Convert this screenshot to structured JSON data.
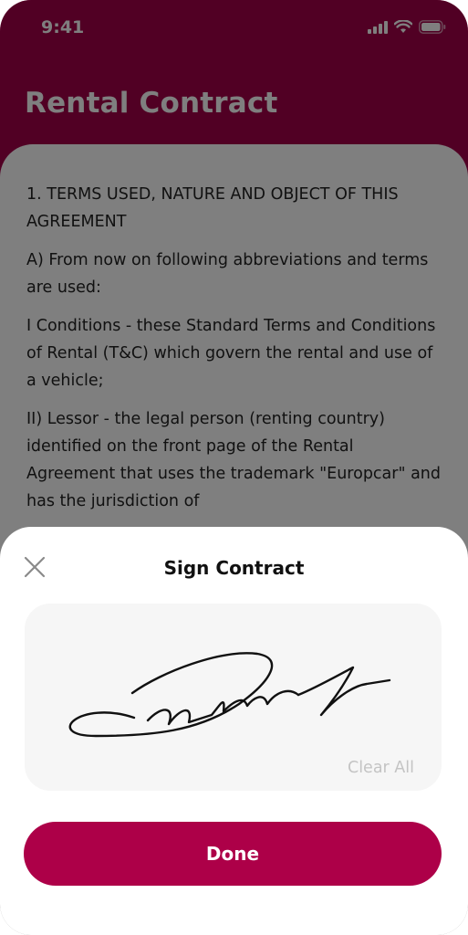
{
  "status_bar": {
    "time": "9:41"
  },
  "page": {
    "title": "Rental Contract"
  },
  "contract": {
    "paragraphs": [
      "1. TERMS USED, NATURE AND OBJECT OF THIS AGREEMENT",
      "A) From now on following abbreviations and terms are used:",
      "I Conditions - these Standard Terms and Conditions of Rental (T&C) which govern the rental and use of a vehicle;",
      "II) Lessor - the legal person (renting country) identified on the front page of the Rental Agreement that uses the trademark \"Europcar\" and has the jurisdiction of"
    ]
  },
  "sheet": {
    "title": "Sign Contract",
    "clear_label": "Clear All",
    "done_label": "Done"
  },
  "icons": [
    "signal-icon",
    "wifi-icon",
    "battery-icon",
    "close-icon"
  ],
  "colors": {
    "brand": "#AD0048",
    "overlay": "rgba(0,0,0,0.5)",
    "pad": "#F6F6F6",
    "muted": "#C4C4C4"
  }
}
